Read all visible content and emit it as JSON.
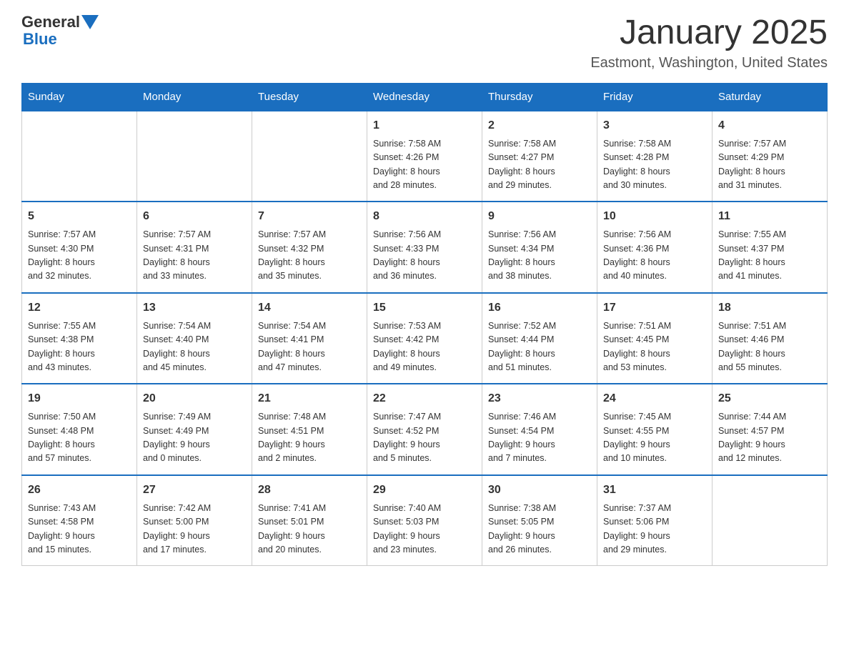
{
  "header": {
    "title": "January 2025",
    "subtitle": "Eastmont, Washington, United States",
    "logo_general": "General",
    "logo_blue": "Blue"
  },
  "weekdays": [
    "Sunday",
    "Monday",
    "Tuesday",
    "Wednesday",
    "Thursday",
    "Friday",
    "Saturday"
  ],
  "weeks": [
    [
      {
        "day": "",
        "info": ""
      },
      {
        "day": "",
        "info": ""
      },
      {
        "day": "",
        "info": ""
      },
      {
        "day": "1",
        "info": "Sunrise: 7:58 AM\nSunset: 4:26 PM\nDaylight: 8 hours\nand 28 minutes."
      },
      {
        "day": "2",
        "info": "Sunrise: 7:58 AM\nSunset: 4:27 PM\nDaylight: 8 hours\nand 29 minutes."
      },
      {
        "day": "3",
        "info": "Sunrise: 7:58 AM\nSunset: 4:28 PM\nDaylight: 8 hours\nand 30 minutes."
      },
      {
        "day": "4",
        "info": "Sunrise: 7:57 AM\nSunset: 4:29 PM\nDaylight: 8 hours\nand 31 minutes."
      }
    ],
    [
      {
        "day": "5",
        "info": "Sunrise: 7:57 AM\nSunset: 4:30 PM\nDaylight: 8 hours\nand 32 minutes."
      },
      {
        "day": "6",
        "info": "Sunrise: 7:57 AM\nSunset: 4:31 PM\nDaylight: 8 hours\nand 33 minutes."
      },
      {
        "day": "7",
        "info": "Sunrise: 7:57 AM\nSunset: 4:32 PM\nDaylight: 8 hours\nand 35 minutes."
      },
      {
        "day": "8",
        "info": "Sunrise: 7:56 AM\nSunset: 4:33 PM\nDaylight: 8 hours\nand 36 minutes."
      },
      {
        "day": "9",
        "info": "Sunrise: 7:56 AM\nSunset: 4:34 PM\nDaylight: 8 hours\nand 38 minutes."
      },
      {
        "day": "10",
        "info": "Sunrise: 7:56 AM\nSunset: 4:36 PM\nDaylight: 8 hours\nand 40 minutes."
      },
      {
        "day": "11",
        "info": "Sunrise: 7:55 AM\nSunset: 4:37 PM\nDaylight: 8 hours\nand 41 minutes."
      }
    ],
    [
      {
        "day": "12",
        "info": "Sunrise: 7:55 AM\nSunset: 4:38 PM\nDaylight: 8 hours\nand 43 minutes."
      },
      {
        "day": "13",
        "info": "Sunrise: 7:54 AM\nSunset: 4:40 PM\nDaylight: 8 hours\nand 45 minutes."
      },
      {
        "day": "14",
        "info": "Sunrise: 7:54 AM\nSunset: 4:41 PM\nDaylight: 8 hours\nand 47 minutes."
      },
      {
        "day": "15",
        "info": "Sunrise: 7:53 AM\nSunset: 4:42 PM\nDaylight: 8 hours\nand 49 minutes."
      },
      {
        "day": "16",
        "info": "Sunrise: 7:52 AM\nSunset: 4:44 PM\nDaylight: 8 hours\nand 51 minutes."
      },
      {
        "day": "17",
        "info": "Sunrise: 7:51 AM\nSunset: 4:45 PM\nDaylight: 8 hours\nand 53 minutes."
      },
      {
        "day": "18",
        "info": "Sunrise: 7:51 AM\nSunset: 4:46 PM\nDaylight: 8 hours\nand 55 minutes."
      }
    ],
    [
      {
        "day": "19",
        "info": "Sunrise: 7:50 AM\nSunset: 4:48 PM\nDaylight: 8 hours\nand 57 minutes."
      },
      {
        "day": "20",
        "info": "Sunrise: 7:49 AM\nSunset: 4:49 PM\nDaylight: 9 hours\nand 0 minutes."
      },
      {
        "day": "21",
        "info": "Sunrise: 7:48 AM\nSunset: 4:51 PM\nDaylight: 9 hours\nand 2 minutes."
      },
      {
        "day": "22",
        "info": "Sunrise: 7:47 AM\nSunset: 4:52 PM\nDaylight: 9 hours\nand 5 minutes."
      },
      {
        "day": "23",
        "info": "Sunrise: 7:46 AM\nSunset: 4:54 PM\nDaylight: 9 hours\nand 7 minutes."
      },
      {
        "day": "24",
        "info": "Sunrise: 7:45 AM\nSunset: 4:55 PM\nDaylight: 9 hours\nand 10 minutes."
      },
      {
        "day": "25",
        "info": "Sunrise: 7:44 AM\nSunset: 4:57 PM\nDaylight: 9 hours\nand 12 minutes."
      }
    ],
    [
      {
        "day": "26",
        "info": "Sunrise: 7:43 AM\nSunset: 4:58 PM\nDaylight: 9 hours\nand 15 minutes."
      },
      {
        "day": "27",
        "info": "Sunrise: 7:42 AM\nSunset: 5:00 PM\nDaylight: 9 hours\nand 17 minutes."
      },
      {
        "day": "28",
        "info": "Sunrise: 7:41 AM\nSunset: 5:01 PM\nDaylight: 9 hours\nand 20 minutes."
      },
      {
        "day": "29",
        "info": "Sunrise: 7:40 AM\nSunset: 5:03 PM\nDaylight: 9 hours\nand 23 minutes."
      },
      {
        "day": "30",
        "info": "Sunrise: 7:38 AM\nSunset: 5:05 PM\nDaylight: 9 hours\nand 26 minutes."
      },
      {
        "day": "31",
        "info": "Sunrise: 7:37 AM\nSunset: 5:06 PM\nDaylight: 9 hours\nand 29 minutes."
      },
      {
        "day": "",
        "info": ""
      }
    ]
  ]
}
